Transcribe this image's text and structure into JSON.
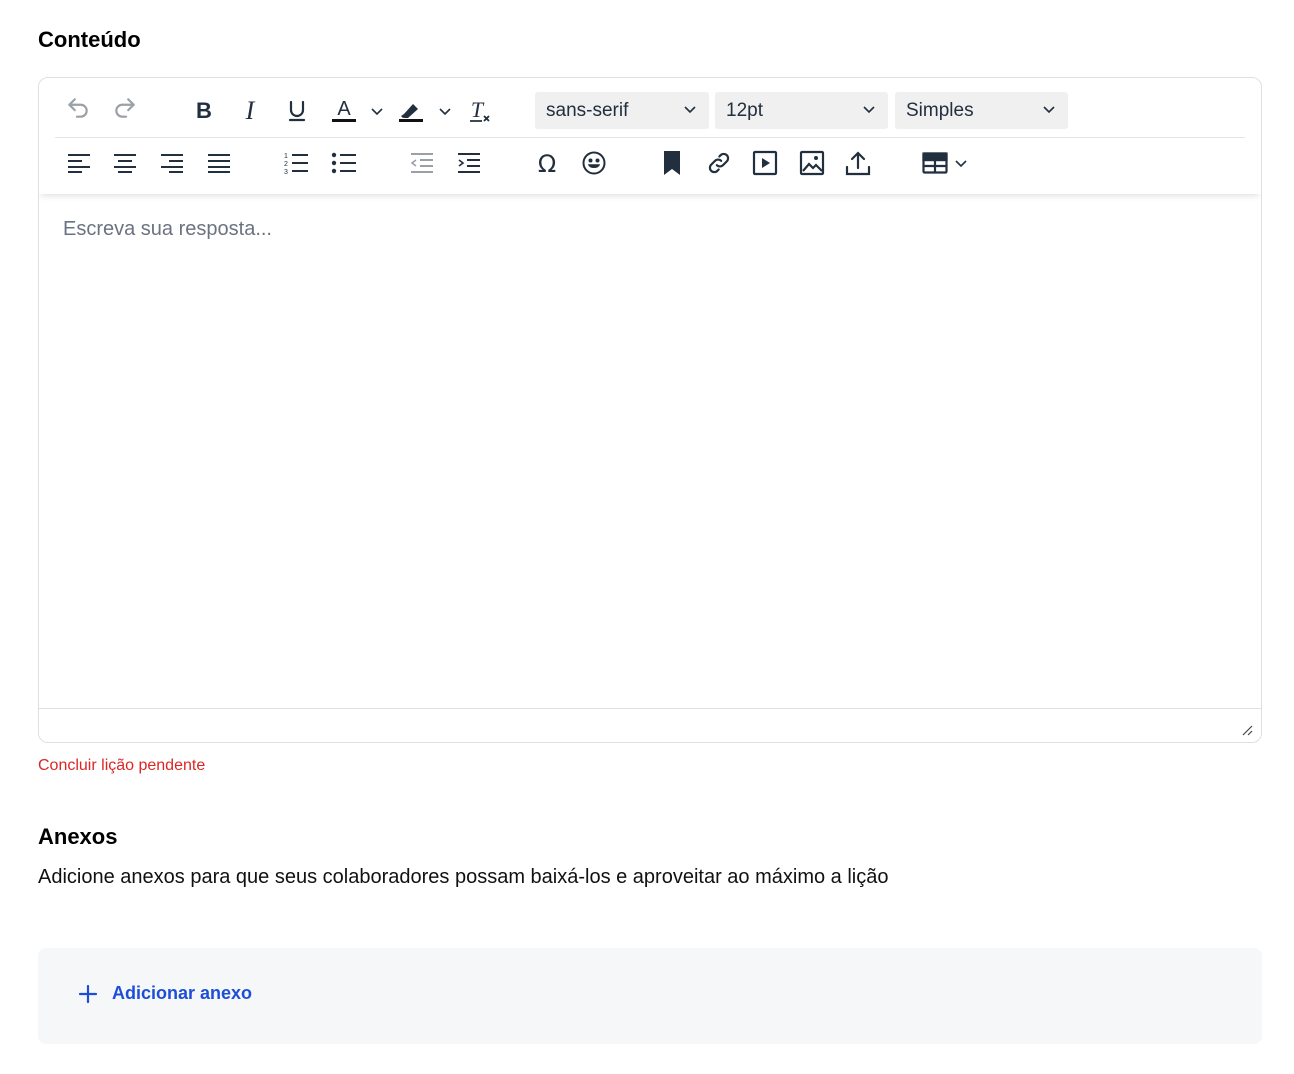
{
  "content_section": {
    "title": "Conteúdo",
    "editor": {
      "font_family": "sans-serif",
      "font_size": "12pt",
      "block_format": "Simples",
      "placeholder": "Escreva sua resposta...",
      "toolbar_icons": [
        "undo-icon",
        "redo-icon",
        "bold-icon",
        "italic-icon",
        "underline-icon",
        "text-color-icon",
        "highlight-color-icon",
        "clear-formatting-icon",
        "align-left-icon",
        "align-center-icon",
        "align-right-icon",
        "align-justify-icon",
        "numbered-list-icon",
        "bullet-list-icon",
        "outdent-icon",
        "indent-icon",
        "special-character-icon",
        "emoji-icon",
        "bookmark-icon",
        "link-icon",
        "media-icon",
        "image-icon",
        "upload-icon",
        "table-icon"
      ]
    },
    "error": "Concluir lição pendente"
  },
  "attachments_section": {
    "title": "Anexos",
    "description": "Adicione anexos para que seus colaboradores possam baixá-los e aproveitar ao máximo a lição",
    "add_label": "Adicionar anexo"
  },
  "colors": {
    "icon": "#222f3e",
    "icon_disabled": "#9aa0a6",
    "error": "#dc2626",
    "link": "#1d4ed8",
    "attach_bg": "#f6f7f9"
  }
}
